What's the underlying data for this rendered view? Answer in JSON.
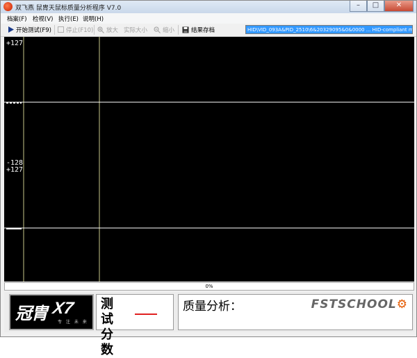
{
  "window": {
    "title": "双飞燕 鼠胄天鼠标质量分析程序 V7.0",
    "controls": {
      "minimize": "–",
      "maximize": "□",
      "close": "✕"
    }
  },
  "menu": [
    "档案(F)",
    "检视(V)",
    "执行(E)",
    "说明(H)"
  ],
  "toolbar": {
    "start": "开始测试(F9)",
    "stop": "停止(F10)",
    "zoom_in": "放大",
    "actual_size": "实际大小",
    "zoom_out": "缩小",
    "save": "结果存档",
    "device": "HID\\VID_093A&PID_2510\\6&20329095&0&0000 ... HID-compliant mouse"
  },
  "plot": {
    "labels": [
      "+127",
      "-128",
      "+127"
    ],
    "colors": {
      "background": "#000000",
      "axis": "#c8c88a",
      "trace": "#ffffff"
    }
  },
  "progress": {
    "value": 0,
    "label": "0%"
  },
  "bottom": {
    "logo_cn": "冠胄",
    "logo_model": "X7",
    "logo_slogan": "专 注 未 来",
    "score_title": "测试分数",
    "analysis_label": "质量分析：",
    "brand_mark_text": "FSTSCHOOL",
    "brand_mark_icon": "gear-icon"
  }
}
